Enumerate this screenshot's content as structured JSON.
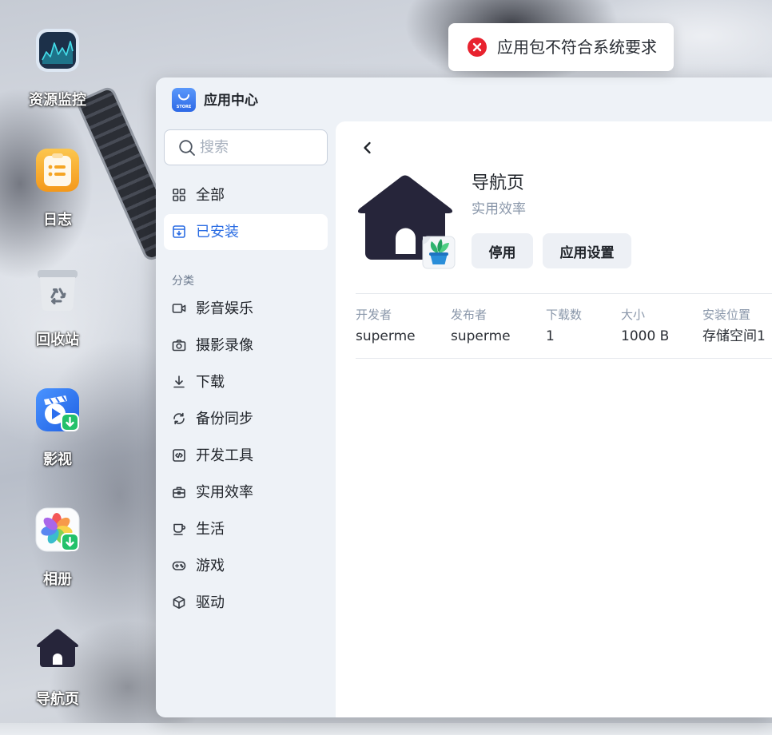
{
  "desktop": {
    "icons": [
      {
        "label": "资源监控",
        "icon": "resource-monitor-icon"
      },
      {
        "label": "日志",
        "icon": "log-icon"
      },
      {
        "label": "回收站",
        "icon": "recycle-bin-icon"
      },
      {
        "label": "影视",
        "icon": "video-app-icon"
      },
      {
        "label": "相册",
        "icon": "photo-album-icon"
      },
      {
        "label": "导航页",
        "icon": "home-icon"
      }
    ]
  },
  "toast": {
    "icon": "error-icon",
    "message": "应用包不符合系统要求"
  },
  "window": {
    "title": "应用中心",
    "logo_icon": "app-store-icon",
    "logo_text": "STORE"
  },
  "sidebar": {
    "search": {
      "placeholder": "搜索",
      "icon": "search-icon"
    },
    "nav": [
      {
        "label": "全部",
        "icon": "grid-icon",
        "selected": false
      },
      {
        "label": "已安装",
        "icon": "installed-icon",
        "selected": true
      }
    ],
    "category_heading": "分类",
    "categories": [
      {
        "label": "影音娱乐",
        "icon": "video-camera-icon"
      },
      {
        "label": "摄影录像",
        "icon": "camera-icon"
      },
      {
        "label": "下载",
        "icon": "download-icon"
      },
      {
        "label": "备份同步",
        "icon": "sync-icon"
      },
      {
        "label": "开发工具",
        "icon": "code-icon"
      },
      {
        "label": "实用效率",
        "icon": "toolbox-icon"
      },
      {
        "label": "生活",
        "icon": "cup-icon"
      },
      {
        "label": "游戏",
        "icon": "gamepad-icon"
      },
      {
        "label": "驱动",
        "icon": "cube-icon"
      }
    ]
  },
  "app_detail": {
    "back_icon": "chevron-left-icon",
    "icon": "home-icon",
    "badge_icon": "app-badge-icon",
    "name": "导航页",
    "category": "实用效率",
    "actions": {
      "disable": "停用",
      "settings": "应用设置"
    },
    "info": [
      {
        "label": "开发者",
        "value": "superme"
      },
      {
        "label": "发布者",
        "value": "superme"
      },
      {
        "label": "下载数",
        "value": "1"
      },
      {
        "label": "大小",
        "value": "1000 B"
      },
      {
        "label": "安装位置",
        "value": "存储空间1"
      }
    ]
  },
  "colors": {
    "accent": "#2b6de3",
    "error": "#e8232f",
    "sidebar_bg": "#eef2f7",
    "button_bg": "#edf0f5",
    "text_primary": "#1f2329",
    "text_secondary": "#8a97aa",
    "app_icon": "#26253a"
  }
}
